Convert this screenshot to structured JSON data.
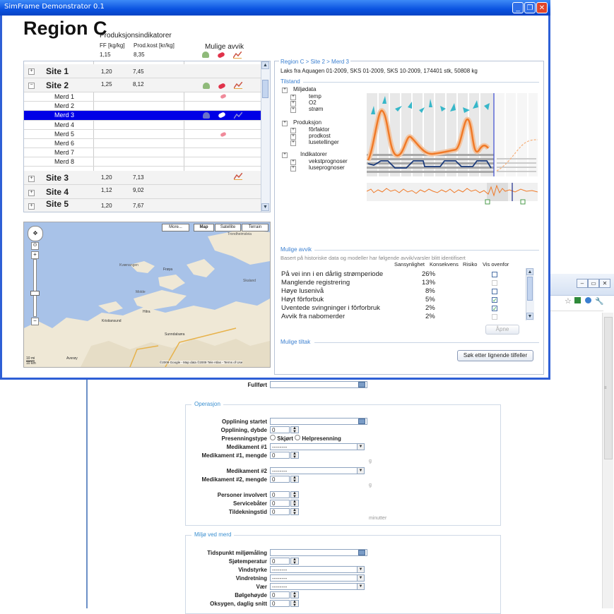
{
  "app": {
    "title": "SimFrame Demonstrator 0.1",
    "region_title": "Region C"
  },
  "indicators": {
    "heading": "Produksjonsindikatorer",
    "col1": "FF [kg/kg]",
    "col2": "Prod.kost [kr/kg]",
    "total_ff": "1,15",
    "total_prod": "8,35",
    "avvik_heading": "Mulige avvik"
  },
  "tree": {
    "rows": [
      {
        "type": "site",
        "name": "Site 1",
        "ff": "1,20",
        "prod": "7,45"
      },
      {
        "type": "site",
        "name": "Site 2",
        "ff": "1,25",
        "prod": "8,12"
      },
      {
        "type": "merd",
        "name": "Merd 1",
        "ff": "",
        "prod": ""
      },
      {
        "type": "merd",
        "name": "Merd 2",
        "ff": "",
        "prod": ""
      },
      {
        "type": "merd",
        "name": "Merd 3",
        "ff": "",
        "prod": ""
      },
      {
        "type": "merd",
        "name": "Merd 4",
        "ff": "",
        "prod": ""
      },
      {
        "type": "merd",
        "name": "Merd 5",
        "ff": "",
        "prod": ""
      },
      {
        "type": "merd",
        "name": "Merd 6",
        "ff": "",
        "prod": ""
      },
      {
        "type": "merd",
        "name": "Merd 7",
        "ff": "",
        "prod": ""
      },
      {
        "type": "merd",
        "name": "Merd 8",
        "ff": "",
        "prod": ""
      },
      {
        "type": "site",
        "name": "Site 3",
        "ff": "1,20",
        "prod": "7,13"
      },
      {
        "type": "site",
        "name": "Site 4",
        "ff": "1,12",
        "prod": "9,02"
      },
      {
        "type": "site",
        "name": "Site 5",
        "ff": "1,20",
        "prod": "7,67"
      }
    ]
  },
  "map": {
    "buttons": [
      "More...",
      "Map",
      "Satellite",
      "Terrain"
    ],
    "place_labels": [
      "Kvænangen",
      "Frøya",
      "Hitra",
      "Kristiansund",
      "Averøy",
      "Sunndalsøra",
      "Trondheimsleia",
      "Skaland",
      "Molde"
    ],
    "scale": [
      "10 mi",
      "10 km"
    ],
    "copyright": "©2009 Google - Map data ©2009 Tele Atlas - Terms of Use"
  },
  "right": {
    "breadcrumb": "Region C > Site 2 > Merd 3",
    "info": "Laks fra Aquagen 01-2009, SKS 01-2009, SKS 10-2009, 174401 stk, 50808 kg",
    "tilstand": "Tilstand",
    "tree": {
      "miljodata": "Miljødata",
      "temp": "temp",
      "o2": "O2",
      "strom": "strøm",
      "produksjon": "Produksjon",
      "forfaktor": "fôrfaktor",
      "prodkost": "prodkost",
      "lusetellinger": "lusetellinger",
      "indikatorer": "Indikatorer",
      "vekstprognoser": "vekstprognoser",
      "luseprognoser": "luseprognoser"
    },
    "avvik": {
      "title": "Mulige avvik",
      "desc": "Basert på historiske data og modeller har følgende avvik/varsler blitt identifisert",
      "headers": [
        "Sansynlighet",
        "Konsekvens",
        "Risiko",
        "Vis ovenfor"
      ],
      "rows": [
        {
          "text": "På vei inn i en dårlig strømperiode",
          "prob": "26%",
          "check": "empty"
        },
        {
          "text": "Manglende registrering",
          "prob": "13%",
          "check": "disabled"
        },
        {
          "text": "Høye lusenivå",
          "prob": "8%",
          "check": "empty"
        },
        {
          "text": "Høyt fôrforbuk",
          "prob": "5%",
          "check": "checked"
        },
        {
          "text": "Uventede svingninger i fôrforbruk",
          "prob": "2%",
          "check": "checked"
        },
        {
          "text": "Avvik fra nabomerder",
          "prob": "2%",
          "check": "disabled"
        }
      ],
      "open_button": "Åpne"
    },
    "tiltak": {
      "title": "Mulige tiltak",
      "search_button": "Søk etter lignende tilfeller"
    }
  },
  "form": {
    "fullfort": "Fullført",
    "operasjon": {
      "legend": "Operasjon",
      "opplining_startet": "Opplining startet",
      "opplining_dybde": "Opplining, dybde",
      "opplining_dybde_val": "0",
      "presenningstype": "Presenningstype",
      "skjort": "Skjørt",
      "helpresenning": "Helpresenning",
      "medikament1": "Medikament #1",
      "medikament1_val": "--------",
      "medikament1_mengde": "Medikament #1, mengde",
      "medikament1_mengde_val": "0",
      "unit_g": "g",
      "medikament2": "Medikament #2",
      "medikament2_val": "--------",
      "medikament2_mengde": "Medikament #2, mengde",
      "medikament2_mengde_val": "0",
      "personer": "Personer involvert",
      "personer_val": "0",
      "servicebater": "Servicebåter",
      "servicebater_val": "0",
      "tildekningstid": "Tildekningstid",
      "tildekningstid_val": "0",
      "unit_minutter": "minutter"
    },
    "miljo": {
      "legend": "Miljø ved merd",
      "tidspunkt": "Tidspunkt miljømåling",
      "sjotemp": "Sjøtemperatur",
      "sjotemp_val": "0",
      "vindstyrke": "Vindstyrke",
      "vindstyrke_val": "--------",
      "vindretning": "Vindretning",
      "vindretning_val": "--------",
      "vaer": "Vær",
      "vaer_val": "--------",
      "bolgehoyde": "Bølgehøyde",
      "bolgehoyde_val": "0",
      "oksygen": "Oksygen, daglig snitt",
      "oksygen_val": "0"
    }
  },
  "colors": {
    "selection": "#0000e6",
    "accent": "#3a7fd0",
    "titlebar": "#0a52e0",
    "curve": "#f07a28",
    "arrow": "#37b7c9"
  }
}
